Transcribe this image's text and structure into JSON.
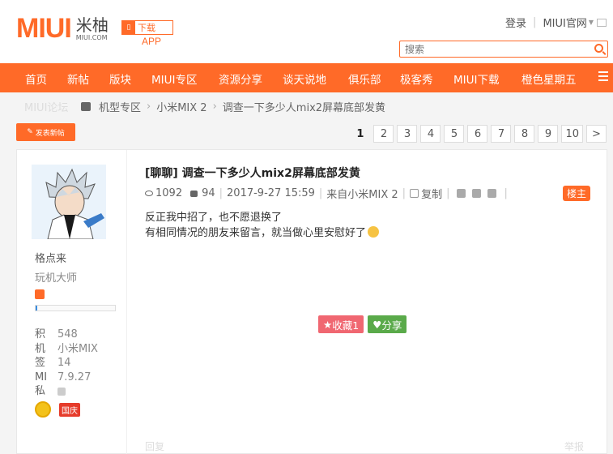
{
  "header": {
    "logo_text": "MIUI",
    "logo_cn": "米柚",
    "logo_domain": "MIUI.COM",
    "app_download": "下载",
    "app_label": "APP",
    "login": "登录",
    "miui_site": "MIUI官网",
    "search_placeholder": "搜索"
  },
  "nav": {
    "items": [
      "首页",
      "新帖",
      "版块",
      "MIUI专区",
      "资源分享",
      "谈天说地",
      "俱乐部",
      "极客秀",
      "MIUI下载",
      "橙色星期五"
    ]
  },
  "breadcrumb": {
    "home": "MIUI论坛",
    "items": [
      "机型专区",
      "小米MIX 2",
      "调查一下多少人mix2屏幕底部发黄"
    ]
  },
  "toolbar": {
    "post_button": "发表新帖",
    "pages": [
      "1",
      "2",
      "3",
      "4",
      "5",
      "6",
      "7",
      "8",
      "9",
      "10",
      ">"
    ],
    "current_page": "1"
  },
  "author": {
    "name": "格点来",
    "group": "玩机大师",
    "level_progress": 0.02,
    "stats": [
      {
        "k": "积",
        "v": "548"
      },
      {
        "k": "机",
        "v": "小米MIX"
      },
      {
        "k": "签",
        "v": "14"
      },
      {
        "k": "MI",
        "v": "7.9.27"
      },
      {
        "k": "私",
        "v": ""
      }
    ],
    "medal_label": "国庆"
  },
  "post": {
    "title": "[聊聊] 调查一下多少人mix2屏幕底部发黄",
    "views": "1092",
    "replies": "94",
    "date": "2017-9-27 15:59",
    "source": "来自小米MIX 2",
    "copy": "复制",
    "owner_badge": "楼主",
    "line1": "反正我中招了，也不愿退换了",
    "line2": "有相同情况的朋友来留言，就当做心里安慰好了",
    "favorite": "收藏1",
    "share": "分享",
    "foot_left": "回复",
    "foot_right": "举报"
  },
  "colors": {
    "accent": "#ff6a28",
    "favorite": "#f06771",
    "share": "#5aaa4a"
  }
}
